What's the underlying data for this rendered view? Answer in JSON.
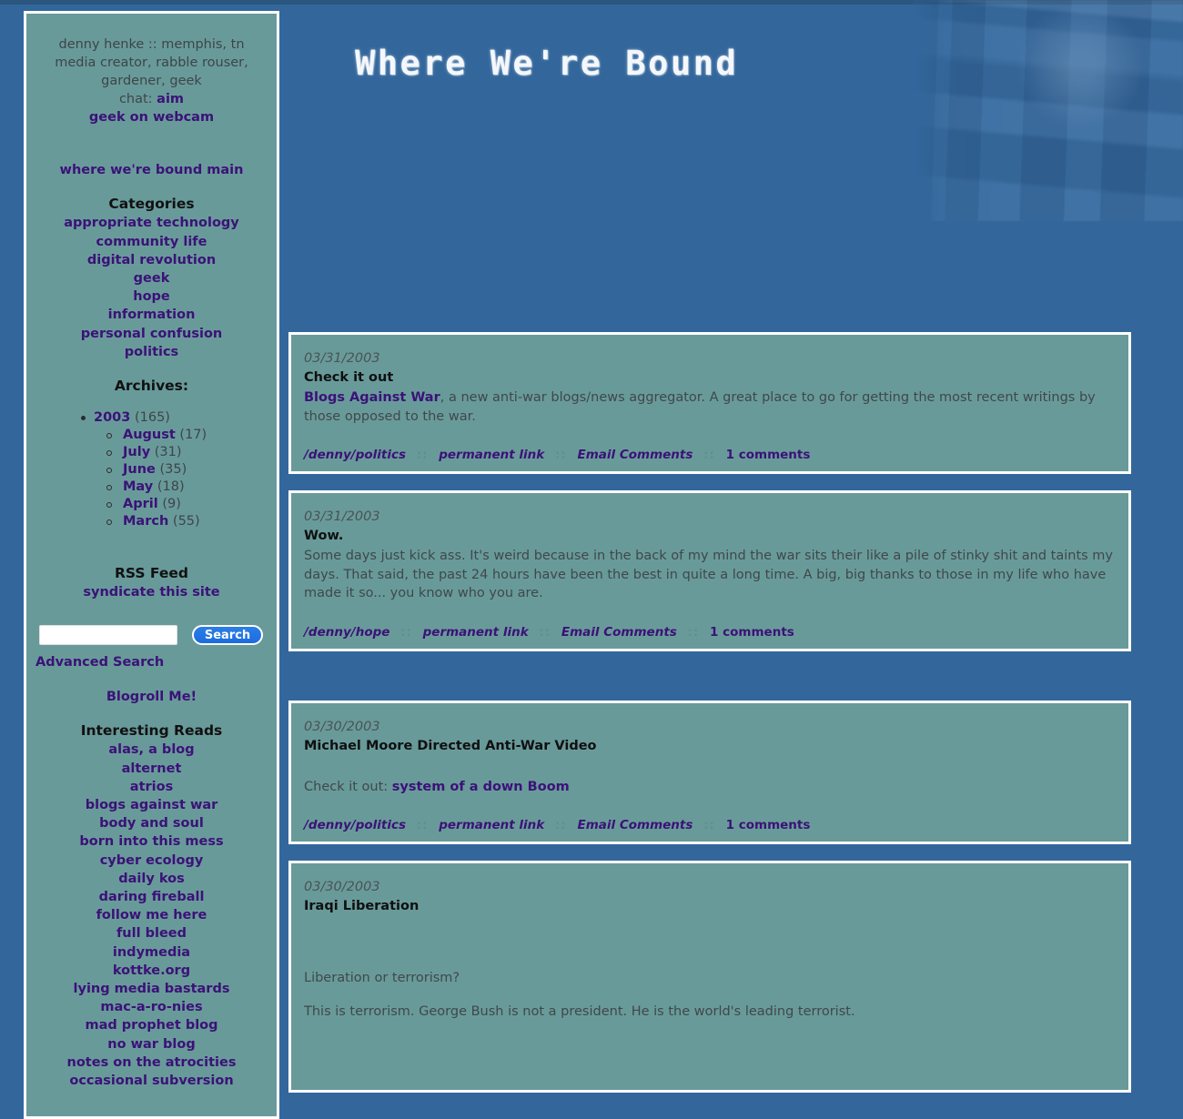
{
  "theme": {
    "page_background": "#33679c",
    "panel_background": "#699a9a",
    "panel_border": "#ffffff",
    "link_color": "#3b1278",
    "body_text_color": "#3f484a",
    "heading_color": "#101010",
    "button_blue": "#1b6ddd"
  },
  "banner": {
    "title": "Where We're Bound",
    "photo_alt": "faded blue protest photo"
  },
  "sidebar": {
    "intro": {
      "line1": "denny henke  ::  memphis, tn",
      "line2": "media creator, rabble rouser,",
      "line3": "gardener, geek",
      "chat_label": "chat: ",
      "chat_link": "aim",
      "webcam_link": "geek on webcam"
    },
    "main_link": "where we're bound main",
    "categories_heading": "Categories",
    "categories": [
      "appropriate technology",
      "community life",
      "digital revolution",
      "geek",
      "hope",
      "information",
      "personal confusion",
      "politics"
    ],
    "archives_heading": "Archives:",
    "archives": {
      "year": "2003",
      "year_count": "(165)",
      "months": [
        {
          "name": "August",
          "count": "(17)"
        },
        {
          "name": "July",
          "count": "(31)"
        },
        {
          "name": "June",
          "count": "(35)"
        },
        {
          "name": "May",
          "count": "(18)"
        },
        {
          "name": "April",
          "count": "(9)"
        },
        {
          "name": "March",
          "count": "(55)"
        }
      ]
    },
    "rss_heading": "RSS Feed",
    "rss_link": "syndicate this site",
    "search": {
      "value": "",
      "placeholder": "",
      "button_label": "Search",
      "advanced_label": "Advanced Search"
    },
    "blogroll_link": "Blogroll Me!",
    "reads_heading": "Interesting Reads",
    "reads": [
      "alas, a blog",
      "alternet",
      "atrios",
      "blogs against war",
      "body and soul",
      "born into this mess",
      "cyber ecology",
      "daily kos",
      "daring fireball",
      "follow me here",
      "full bleed",
      "indymedia",
      "kottke.org",
      "lying media bastards",
      "mac-a-ro-nies",
      "mad prophet blog",
      "no war blog",
      "notes on the atrocities",
      "occasional subversion"
    ]
  },
  "posts": [
    {
      "date": "03/31/2003",
      "title": "Check it out",
      "body_link": "Blogs Against War",
      "body_text": ", a new anti-war blogs/news aggregator. A great place to go for getting the most recent writings by those opposed to the war.",
      "category": "/denny/politics",
      "permalink": "permanent link",
      "email_comments": "Email Comments",
      "comments": "1 comments",
      "sep": "::"
    },
    {
      "date": "03/31/2003",
      "title": "Wow.",
      "body_text": "Some days just kick ass. It's weird because in the back of my mind the war sits their like a pile of stinky shit and taints my days. That said, the past 24 hours have been the best in quite a long time. A big, big thanks to those in my life who have made it so... you know who you are.",
      "category": "/denny/hope",
      "permalink": "permanent link",
      "email_comments": "Email Comments",
      "comments": "1 comments",
      "sep": "::"
    },
    {
      "date": "03/30/2003",
      "title": "Michael Moore Directed Anti-War Video",
      "body_prefix": "Check it out: ",
      "body_link": "system of a down Boom",
      "category": "/denny/politics",
      "permalink": "permanent link",
      "email_comments": "Email Comments",
      "comments": "1 comments",
      "sep": "::"
    },
    {
      "date": "03/30/2003",
      "title": "Iraqi Liberation",
      "para1": "Liberation or terrorism?",
      "para2": "This is terrorism. George Bush is not a president. He is the world's leading terrorist."
    }
  ]
}
